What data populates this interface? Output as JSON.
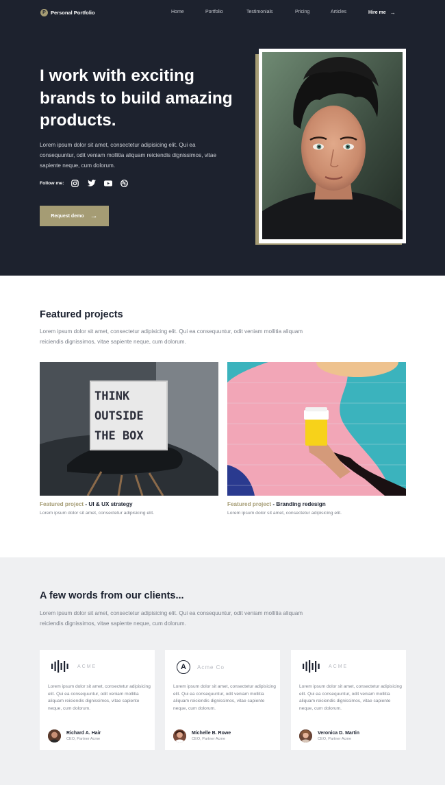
{
  "nav": {
    "logo_letter": "P",
    "brand": "Personal Portfolio",
    "links": [
      "Home",
      "Portfolio",
      "Testimonials",
      "Pricing",
      "Articles"
    ],
    "cta": "Hire me"
  },
  "hero": {
    "title": "I work with exciting brands to build amazing products.",
    "description": "Lorem ipsum dolor sit amet, consectetur adipisicing elit. Qui ea consequuntur, odit veniam mollitia aliquam reiciendis dignissimos, vitae sapiente neque, cum dolorum.",
    "follow_label": "Follow me:",
    "social_icons": [
      "instagram-icon",
      "twitter-icon",
      "youtube-icon",
      "dribbble-icon"
    ],
    "button": "Request demo"
  },
  "featured": {
    "title": "Featured projects",
    "description": "Lorem ipsum dolor sit amet, consectetur adipisicing elit. Qui ea consequuntur, odit veniam mollitia aliquam reiciendis dignissimos, vitae sapiente neque, cum dolorum.",
    "projects": [
      {
        "prefix": "Featured project",
        "name": " - UI & UX strategy",
        "desc": "Lorem ipsum dolor sit amet, consectetur adipisicing elit.",
        "sign_lines": [
          "THINK",
          "OUTSIDE",
          "THE  BOX"
        ]
      },
      {
        "prefix": "Featured project",
        "name": " - Branding redesign",
        "desc": "Lorem ipsum dolor sit amet, consectetur adipisicing elit."
      }
    ]
  },
  "testimonials": {
    "title": "A few words from our clients...",
    "description": "Lorem ipsum dolor sit amet, consectetur adipisicing elit. Qui ea consequuntur, odit veniam mollitia aliquam reiciendis dignissimos, vitae sapiente neque, cum dolorum.",
    "cards": [
      {
        "logo": "ACME",
        "logo_icon": "soundwave-icon",
        "quote": "Lorem ipsum dolor sit amet, consectetur adipisicing elit. Qui ea consequuntur, odit veniam mollitia aliquam reiciendis dignissimos, vitae sapiente neque, cum dolorum.",
        "name": "Richard A. Hair",
        "role": "CEO, Partner Acme"
      },
      {
        "logo": "Acme Co",
        "logo_letter": "A",
        "logo_icon": "circle-a-icon",
        "quote": "Lorem ipsum dolor sit amet, consectetur adipisicing elit. Qui ea consequuntur, odit veniam mollitia aliquam reiciendis dignissimos, vitae sapiente neque, cum dolorum.",
        "name": "Michelle B. Rowe",
        "role": "CEO, Partner Acme"
      },
      {
        "logo": "ACME",
        "logo_icon": "soundwave-icon",
        "quote": "Lorem ipsum dolor sit amet, consectetur adipisicing elit. Qui ea consequuntur, odit veniam mollitia aliquam reiciendis dignissimos, vitae sapiente neque, cum dolorum.",
        "name": "Veronica D. Martin",
        "role": "CEO, Partner Acme"
      }
    ]
  },
  "colors": {
    "dark": "#1d222e",
    "accent": "#a59c74",
    "light_bg": "#eff0f2"
  }
}
